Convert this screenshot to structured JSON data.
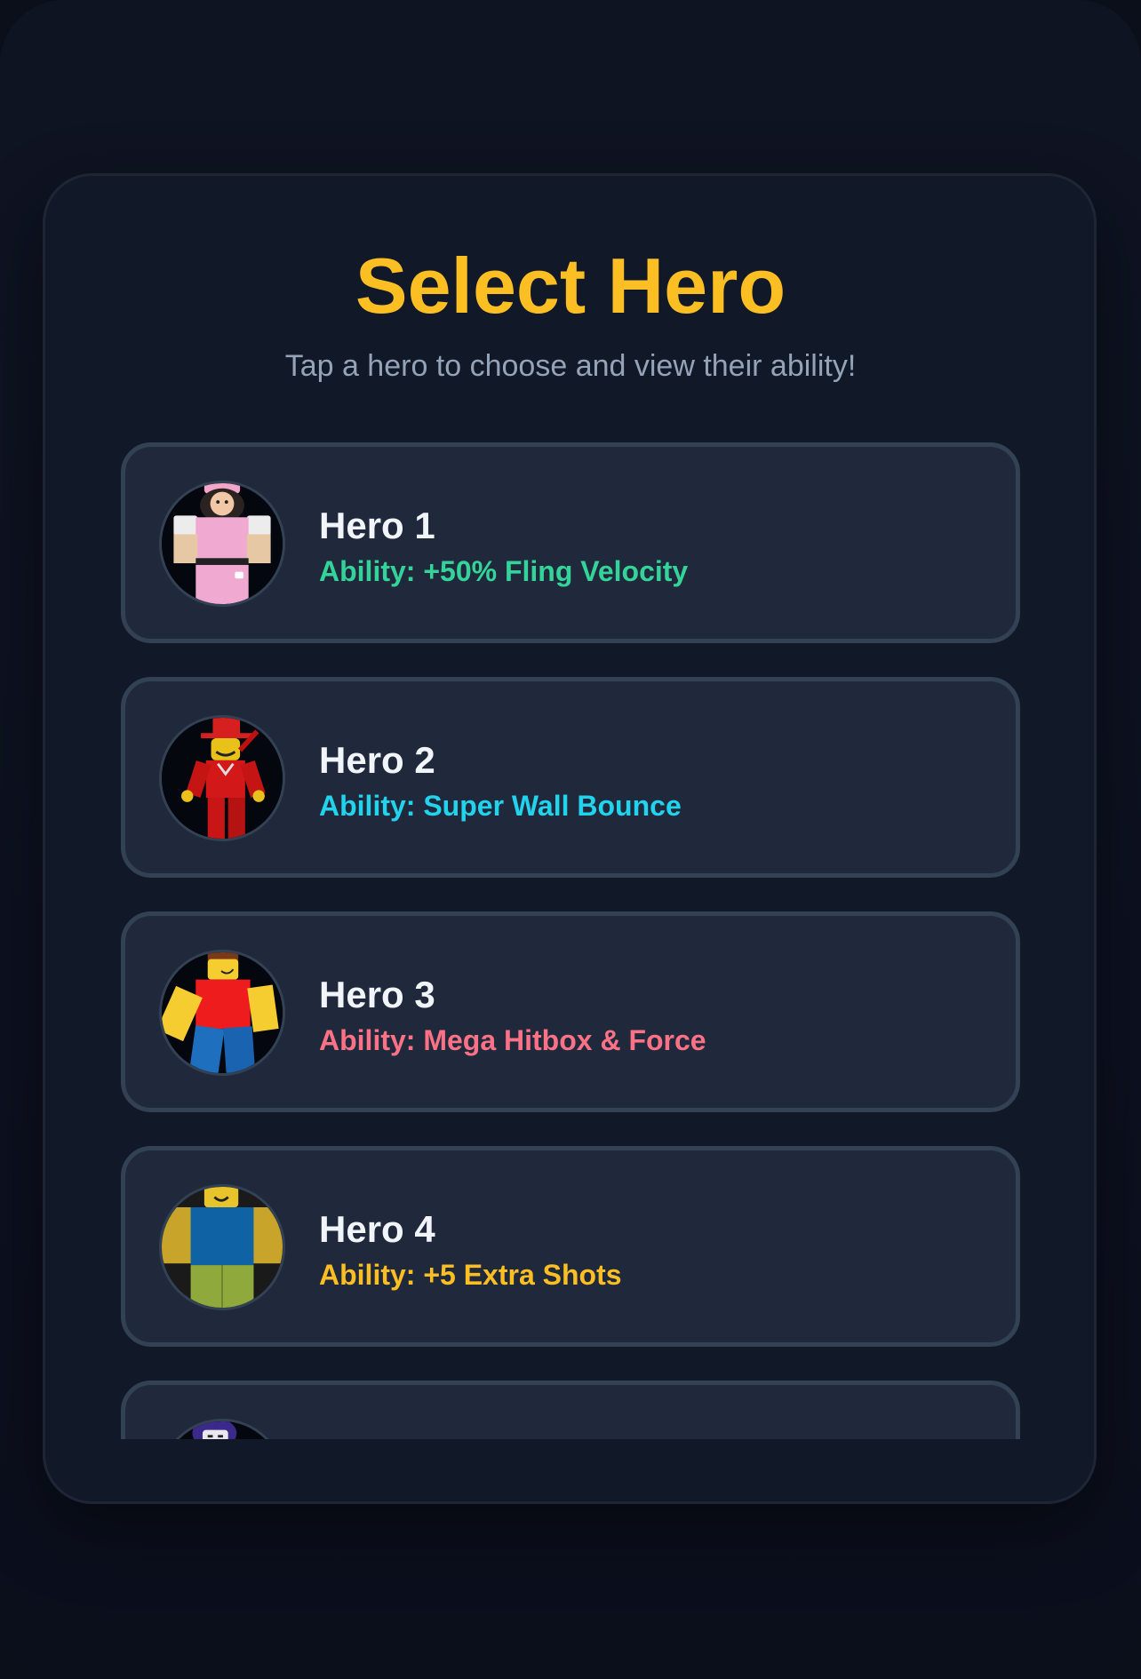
{
  "header": {
    "title": "Select Hero",
    "subtitle": "Tap a hero to choose and view their ability!"
  },
  "colors": {
    "title": "#fbbf24",
    "subtitle": "#94a3b8",
    "card_bg": "#1f293b",
    "card_border": "#334155"
  },
  "heroes": [
    {
      "name": "Hero 1",
      "ability": "Ability: +50% Fling Velocity",
      "ability_color": "#34d399",
      "avatar_icon": "pink-outfit-avatar-icon"
    },
    {
      "name": "Hero 2",
      "ability": "Ability: Super Wall Bounce",
      "ability_color": "#22d3ee",
      "avatar_icon": "red-suit-avatar-icon"
    },
    {
      "name": "Hero 3",
      "ability": "Ability: Mega Hitbox & Force",
      "ability_color": "#fb7185",
      "avatar_icon": "classic-red-shirt-avatar-icon"
    },
    {
      "name": "Hero 4",
      "ability": "Ability: +5 Extra Shots",
      "ability_color": "#fbbf24",
      "avatar_icon": "noob-avatar-icon"
    },
    {
      "name": "",
      "ability": "",
      "ability_color": "#a78bfa",
      "avatar_icon": "purple-hair-avatar-icon"
    }
  ]
}
